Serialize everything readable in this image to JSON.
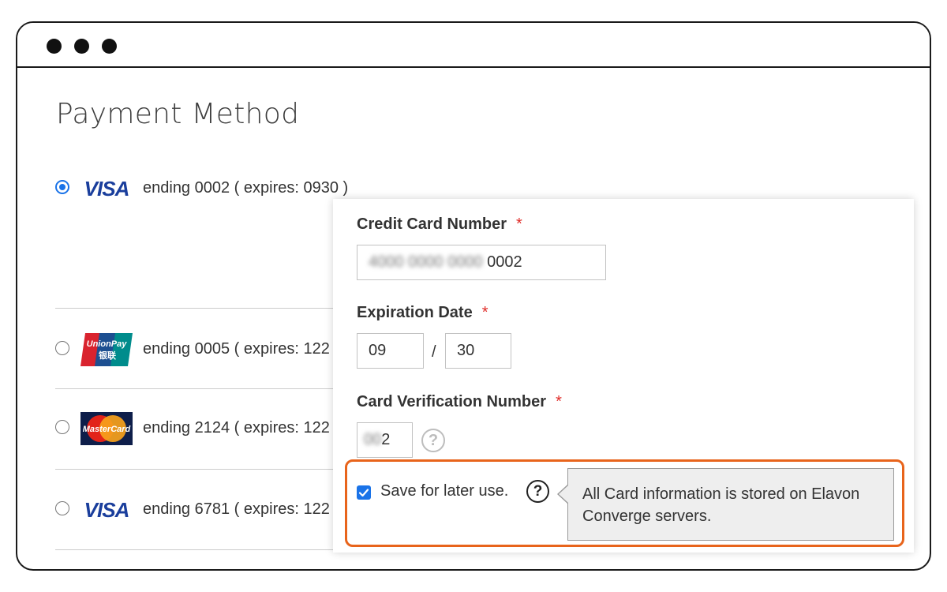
{
  "page": {
    "title": "Payment Method"
  },
  "saved_cards": [
    {
      "brand": "VISA",
      "icon": "visa-logo",
      "text": "ending 0002 ( expires: 0930 )",
      "selected": true
    },
    {
      "brand": "UnionPay",
      "icon": "unionpay-logo",
      "logo_line1": "UnionPay",
      "logo_line2": "银联",
      "text": "ending 0005 ( expires: 122",
      "selected": false
    },
    {
      "brand": "MasterCard",
      "icon": "mastercard-logo",
      "logo_text": "MasterCard",
      "text": "ending 2124 ( expires: 122",
      "selected": false
    },
    {
      "brand": "VISA",
      "icon": "visa-logo",
      "text": "ending 6781 ( expires: 122",
      "selected": false
    }
  ],
  "form": {
    "card_number": {
      "label": "Credit Card Number",
      "required_mark": "*",
      "masked_value": "4000 0000 0000",
      "value_suffix": "0002"
    },
    "expiration": {
      "label": "Expiration Date",
      "required_mark": "*",
      "month": "09",
      "separator": "/",
      "year": "30"
    },
    "cvv": {
      "label": "Card Verification Number",
      "required_mark": "*",
      "masked_value": "00",
      "value_suffix": "2",
      "help_icon": "question-circle-icon",
      "help_glyph": "?"
    },
    "save": {
      "label": "Save for later use.",
      "checked": true,
      "help_icon": "question-circle-icon",
      "help_glyph": "?"
    },
    "tooltip": {
      "text": "All Card information is stored on Elavon Converge servers."
    }
  },
  "colors": {
    "radio_selected": "#1a73e8",
    "checkbox": "#1a73e8",
    "required": "#e02b27",
    "highlight_border": "#e8641b",
    "visa_blue": "#1a3e9c"
  }
}
